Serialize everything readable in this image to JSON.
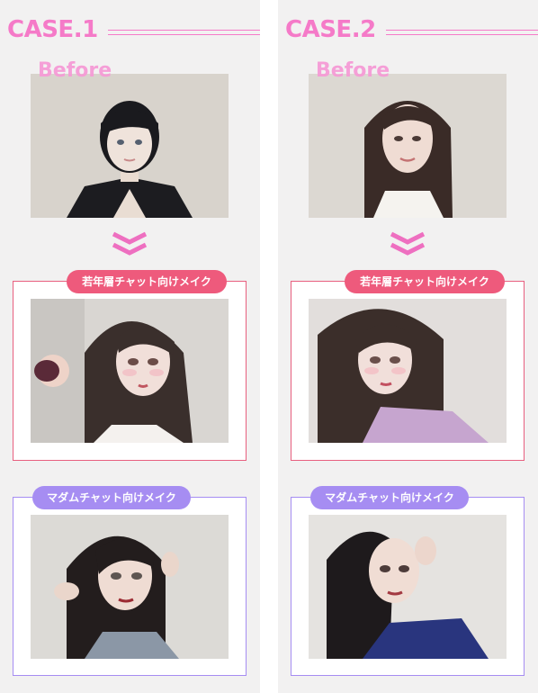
{
  "cases": [
    {
      "title": "CASE.1",
      "before_label": "Before",
      "young_label": "若年層チャット向けメイク",
      "madam_label": "マダムチャット向けメイク"
    },
    {
      "title": "CASE.2",
      "before_label": "Before",
      "young_label": "若年層チャット向けメイク",
      "madam_label": "マダムチャット向けメイク"
    }
  ],
  "colors": {
    "case_title": "#f57ac8",
    "young_accent": "#ee5a7c",
    "madam_accent": "#a68df2",
    "column_bg": "#f2f1f1"
  },
  "icons": {
    "arrow": "double-chevron-down-icon"
  }
}
